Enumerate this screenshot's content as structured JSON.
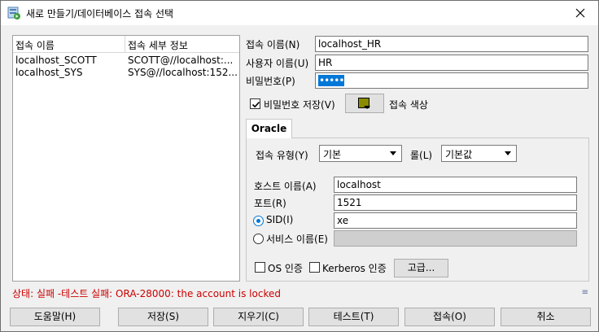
{
  "window": {
    "title": "새로 만들기/데이터베이스 접속 선택"
  },
  "connections": {
    "headers": [
      "접속 이름",
      "접속 세부 정보"
    ],
    "rows": [
      [
        "localhost_SCOTT",
        "SCOTT@//localhost:..."
      ],
      [
        "localhost_SYS",
        "SYS@//localhost:152..."
      ]
    ]
  },
  "form": {
    "conn_name_label": "접속 이름(N)",
    "conn_name_value": "localhost_HR",
    "username_label": "사용자 이름(U)",
    "username_value": "HR",
    "password_label": "비밀번호(P)",
    "password_dots": "•••••",
    "save_password_label": "비밀번호 저장(V)",
    "save_password_checked": true,
    "conn_color_label": "접속 색상",
    "conn_color": "#8b8b00"
  },
  "tab": {
    "label": "Oracle"
  },
  "oracle": {
    "conn_type_label": "접속 유형(Y)",
    "conn_type_value": "기본",
    "role_label": "롤(L)",
    "role_value": "기본값",
    "hostname_label": "호스트 이름(A)",
    "hostname_value": "localhost",
    "port_label": "포트(R)",
    "port_value": "1521",
    "sid_label": "SID(I)",
    "sid_value": "xe",
    "sid_selected": true,
    "service_label": "서비스 이름(E)",
    "service_value": "",
    "os_auth_label": "OS 인증",
    "kerberos_label": "Kerberos 인증",
    "advanced_label": "고급..."
  },
  "status": {
    "text": "상태: 실패 -테스트 실패: ORA-28000: the account is locked",
    "color": "#cc0000"
  },
  "buttons": {
    "help": "도움말(H)",
    "save": "저장(S)",
    "clear": "지우기(C)",
    "test": "테스트(T)",
    "connect": "접속(O)",
    "cancel": "취소"
  }
}
